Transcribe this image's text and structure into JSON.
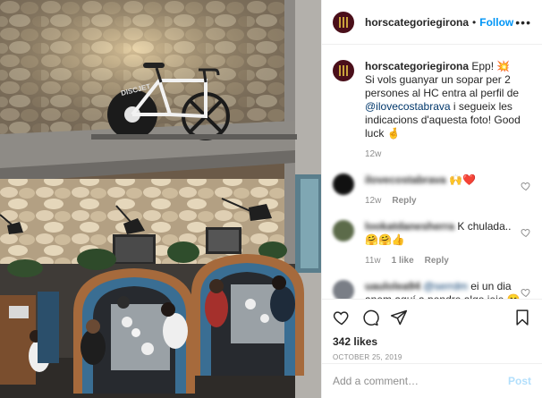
{
  "post": {
    "username": "horscategoriegirona",
    "follow_label": "Follow",
    "separator": "•",
    "more_label": "•••"
  },
  "photo": {
    "alt": "Restaurant interior with bicycle mounted on stone wall",
    "wheel_text": "DISCJET"
  },
  "caption": {
    "username": "horscategoriegirona",
    "text_before": " Epp! 💥 Si vols guanyar un sopar per 2 persones al HC entra al perfil de ",
    "mention": "@ilovecostabrava",
    "text_after": " i segueix les indicacions d'aquesta foto! Good luck 🤞",
    "time": "12w"
  },
  "comments": [
    {
      "username": "ilovecostabrava",
      "text": "🙌❤️",
      "time": "12w",
      "likes": "",
      "reply_label": "Reply",
      "avatar_color": "#1a1a1a"
    },
    {
      "username": "lookatdanesherra",
      "text": "K chulada..🤗🤗👍",
      "time": "11w",
      "likes": "1 like",
      "reply_label": "Reply",
      "avatar_color": "#5c6b4a"
    },
    {
      "username": "uaulolea94",
      "mention": "@serrdm",
      "text": " ei un dia anem aquí a pendre algo jeje 😊",
      "time": "",
      "likes": "",
      "reply_label": "",
      "avatar_color": "#7a7e86"
    }
  ],
  "actions": {
    "like_icon": "heart-outline-icon",
    "comment_icon": "comment-bubble-icon",
    "share_icon": "paper-plane-icon",
    "save_icon": "bookmark-icon",
    "likes_text": "342 likes",
    "date_text": "October 25, 2019"
  },
  "add_comment": {
    "placeholder": "Add a comment…",
    "post_label": "Post"
  },
  "colors": {
    "link": "#0095f6",
    "mention": "#00376b",
    "muted": "#8e8e8e",
    "post_disabled": "#b2dffc"
  }
}
